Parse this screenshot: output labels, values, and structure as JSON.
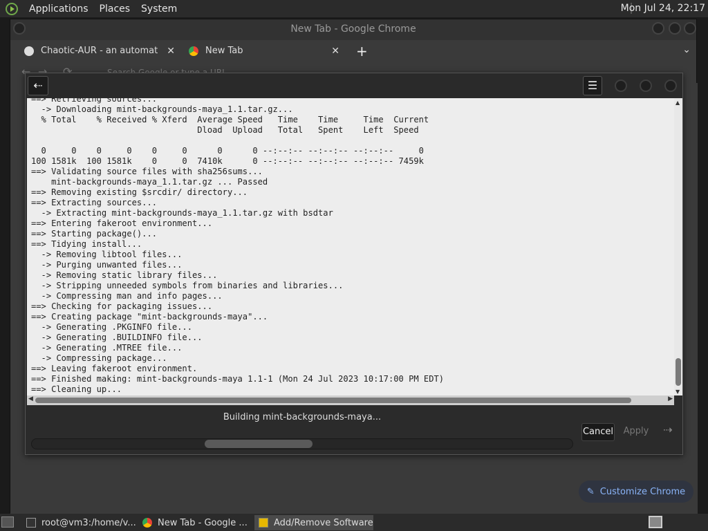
{
  "panel": {
    "menus": [
      "Applications",
      "Places",
      "System"
    ],
    "clock": "Mon Jul 24, 22:17"
  },
  "chrome": {
    "window_title": "New Tab - Google Chrome",
    "tabs": [
      {
        "label": "Chaotic-AUR - an automated b",
        "close": "✕"
      },
      {
        "label": "New Tab",
        "close": "✕"
      }
    ],
    "new_tab": "+",
    "dropdown": "⌄",
    "omnibox_placeholder": "Search Google or type a URL",
    "customize_label": "Customize Chrome"
  },
  "pamac": {
    "back_icon": "⇠",
    "menu_icon": "☰",
    "terminal_lines": [
      "==> Retrieving sources...",
      "  -> Downloading mint-backgrounds-maya_1.1.tar.gz...",
      "  % Total    % Received % Xferd  Average Speed   Time    Time     Time  Current",
      "                                 Dload  Upload   Total   Spent    Left  Speed",
      "",
      "  0     0    0     0    0     0      0      0 --:--:-- --:--:-- --:--:--     0",
      "100 1581k  100 1581k    0     0  7410k      0 --:--:-- --:--:-- --:--:-- 7459k",
      "==> Validating source files with sha256sums...",
      "    mint-backgrounds-maya_1.1.tar.gz ... Passed",
      "==> Removing existing $srcdir/ directory...",
      "==> Extracting sources...",
      "  -> Extracting mint-backgrounds-maya_1.1.tar.gz with bsdtar",
      "==> Entering fakeroot environment...",
      "==> Starting package()...",
      "==> Tidying install...",
      "  -> Removing libtool files...",
      "  -> Purging unwanted files...",
      "  -> Removing static library files...",
      "  -> Stripping unneeded symbols from binaries and libraries...",
      "  -> Compressing man and info pages...",
      "==> Checking for packaging issues...",
      "==> Creating package \"mint-backgrounds-maya\"...",
      "  -> Generating .PKGINFO file...",
      "  -> Generating .BUILDINFO file...",
      "  -> Generating .MTREE file...",
      "  -> Compressing package...",
      "==> Leaving fakeroot environment.",
      "==> Finished making: mint-backgrounds-maya 1.1-1 (Mon 24 Jul 2023 10:17:00 PM EDT)",
      "==> Cleaning up..."
    ],
    "status": "Building mint-backgrounds-maya...",
    "cancel_label": "Cancel",
    "apply_label": "Apply",
    "next_icon": "⇢"
  },
  "taskbar": {
    "tasks": [
      {
        "label": "root@vm3:/home/v..."
      },
      {
        "label": "New Tab - Google ..."
      },
      {
        "label": "Add/Remove Software"
      }
    ]
  },
  "colors": {
    "accent": "#8ab4f8",
    "terminal_bg": "#ededed"
  }
}
